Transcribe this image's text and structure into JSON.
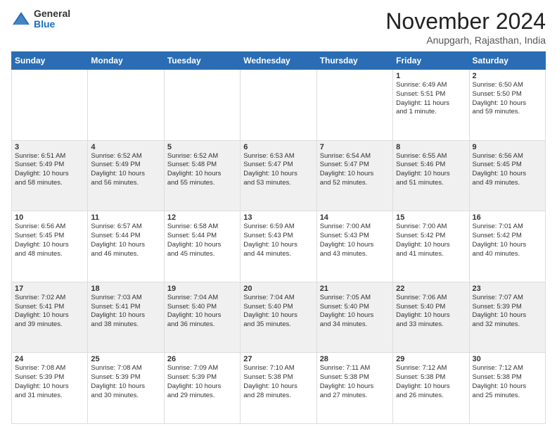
{
  "header": {
    "logo_line1": "General",
    "logo_line2": "Blue",
    "month": "November 2024",
    "location": "Anupgarh, Rajasthan, India"
  },
  "weekdays": [
    "Sunday",
    "Monday",
    "Tuesday",
    "Wednesday",
    "Thursday",
    "Friday",
    "Saturday"
  ],
  "weeks": [
    [
      {
        "day": "",
        "info": ""
      },
      {
        "day": "",
        "info": ""
      },
      {
        "day": "",
        "info": ""
      },
      {
        "day": "",
        "info": ""
      },
      {
        "day": "",
        "info": ""
      },
      {
        "day": "1",
        "info": "Sunrise: 6:49 AM\nSunset: 5:51 PM\nDaylight: 11 hours\nand 1 minute."
      },
      {
        "day": "2",
        "info": "Sunrise: 6:50 AM\nSunset: 5:50 PM\nDaylight: 10 hours\nand 59 minutes."
      }
    ],
    [
      {
        "day": "3",
        "info": "Sunrise: 6:51 AM\nSunset: 5:49 PM\nDaylight: 10 hours\nand 58 minutes."
      },
      {
        "day": "4",
        "info": "Sunrise: 6:52 AM\nSunset: 5:49 PM\nDaylight: 10 hours\nand 56 minutes."
      },
      {
        "day": "5",
        "info": "Sunrise: 6:52 AM\nSunset: 5:48 PM\nDaylight: 10 hours\nand 55 minutes."
      },
      {
        "day": "6",
        "info": "Sunrise: 6:53 AM\nSunset: 5:47 PM\nDaylight: 10 hours\nand 53 minutes."
      },
      {
        "day": "7",
        "info": "Sunrise: 6:54 AM\nSunset: 5:47 PM\nDaylight: 10 hours\nand 52 minutes."
      },
      {
        "day": "8",
        "info": "Sunrise: 6:55 AM\nSunset: 5:46 PM\nDaylight: 10 hours\nand 51 minutes."
      },
      {
        "day": "9",
        "info": "Sunrise: 6:56 AM\nSunset: 5:45 PM\nDaylight: 10 hours\nand 49 minutes."
      }
    ],
    [
      {
        "day": "10",
        "info": "Sunrise: 6:56 AM\nSunset: 5:45 PM\nDaylight: 10 hours\nand 48 minutes."
      },
      {
        "day": "11",
        "info": "Sunrise: 6:57 AM\nSunset: 5:44 PM\nDaylight: 10 hours\nand 46 minutes."
      },
      {
        "day": "12",
        "info": "Sunrise: 6:58 AM\nSunset: 5:44 PM\nDaylight: 10 hours\nand 45 minutes."
      },
      {
        "day": "13",
        "info": "Sunrise: 6:59 AM\nSunset: 5:43 PM\nDaylight: 10 hours\nand 44 minutes."
      },
      {
        "day": "14",
        "info": "Sunrise: 7:00 AM\nSunset: 5:43 PM\nDaylight: 10 hours\nand 43 minutes."
      },
      {
        "day": "15",
        "info": "Sunrise: 7:00 AM\nSunset: 5:42 PM\nDaylight: 10 hours\nand 41 minutes."
      },
      {
        "day": "16",
        "info": "Sunrise: 7:01 AM\nSunset: 5:42 PM\nDaylight: 10 hours\nand 40 minutes."
      }
    ],
    [
      {
        "day": "17",
        "info": "Sunrise: 7:02 AM\nSunset: 5:41 PM\nDaylight: 10 hours\nand 39 minutes."
      },
      {
        "day": "18",
        "info": "Sunrise: 7:03 AM\nSunset: 5:41 PM\nDaylight: 10 hours\nand 38 minutes."
      },
      {
        "day": "19",
        "info": "Sunrise: 7:04 AM\nSunset: 5:40 PM\nDaylight: 10 hours\nand 36 minutes."
      },
      {
        "day": "20",
        "info": "Sunrise: 7:04 AM\nSunset: 5:40 PM\nDaylight: 10 hours\nand 35 minutes."
      },
      {
        "day": "21",
        "info": "Sunrise: 7:05 AM\nSunset: 5:40 PM\nDaylight: 10 hours\nand 34 minutes."
      },
      {
        "day": "22",
        "info": "Sunrise: 7:06 AM\nSunset: 5:40 PM\nDaylight: 10 hours\nand 33 minutes."
      },
      {
        "day": "23",
        "info": "Sunrise: 7:07 AM\nSunset: 5:39 PM\nDaylight: 10 hours\nand 32 minutes."
      }
    ],
    [
      {
        "day": "24",
        "info": "Sunrise: 7:08 AM\nSunset: 5:39 PM\nDaylight: 10 hours\nand 31 minutes."
      },
      {
        "day": "25",
        "info": "Sunrise: 7:08 AM\nSunset: 5:39 PM\nDaylight: 10 hours\nand 30 minutes."
      },
      {
        "day": "26",
        "info": "Sunrise: 7:09 AM\nSunset: 5:39 PM\nDaylight: 10 hours\nand 29 minutes."
      },
      {
        "day": "27",
        "info": "Sunrise: 7:10 AM\nSunset: 5:38 PM\nDaylight: 10 hours\nand 28 minutes."
      },
      {
        "day": "28",
        "info": "Sunrise: 7:11 AM\nSunset: 5:38 PM\nDaylight: 10 hours\nand 27 minutes."
      },
      {
        "day": "29",
        "info": "Sunrise: 7:12 AM\nSunset: 5:38 PM\nDaylight: 10 hours\nand 26 minutes."
      },
      {
        "day": "30",
        "info": "Sunrise: 7:12 AM\nSunset: 5:38 PM\nDaylight: 10 hours\nand 25 minutes."
      }
    ]
  ]
}
